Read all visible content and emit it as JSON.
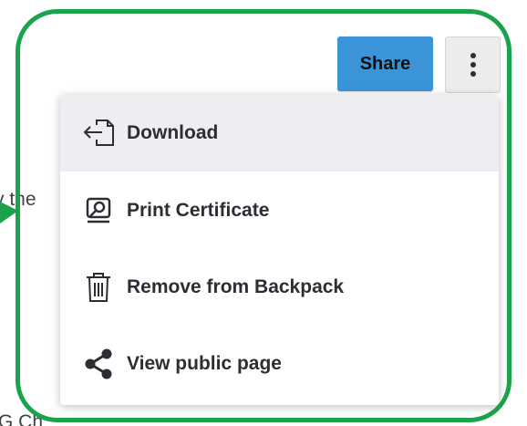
{
  "background": {
    "text_top": "v the",
    "text_bottom": "G Ch"
  },
  "toolbar": {
    "share_label": "Share",
    "more_icon": "vertical-ellipsis-icon"
  },
  "menu": {
    "items": [
      {
        "label": "Download",
        "icon": "download-icon",
        "active": true
      },
      {
        "label": "Print Certificate",
        "icon": "print-certificate-icon",
        "active": false
      },
      {
        "label": "Remove from Backpack",
        "icon": "trash-icon",
        "active": false
      },
      {
        "label": "View public page",
        "icon": "share-icon",
        "active": false
      }
    ]
  },
  "colors": {
    "highlight": "#1aa34a",
    "share_button": "#3b93d8",
    "active_item_bg": "#eeeef2"
  }
}
